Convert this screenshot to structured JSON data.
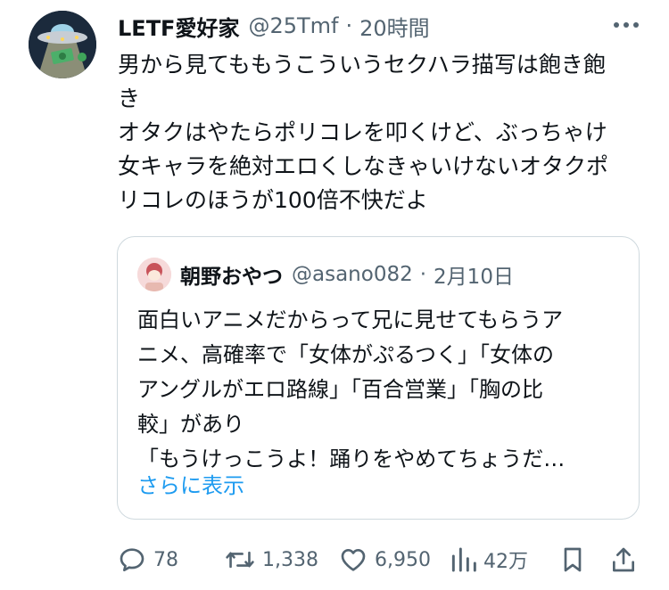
{
  "tweet": {
    "display_name": "LETF愛好家",
    "handle": "@25Tmf",
    "separator": "·",
    "time": "20時間",
    "text": "男から見てももうこういうセクハラ描写は飽き飽\nき\nオタクはやたらポリコレを叩くけど、ぶっちゃけ\n女キャラを絶対エロくしなきゃいけないオタクポ\nリコレのほうが100倍不快だよ"
  },
  "quote": {
    "display_name": "朝野おやつ",
    "handle": "@asano082",
    "separator": "·",
    "time": "2月10日",
    "text": "面白いアニメだからって兄に見せてもらうア\nニメ、高確率で「女体がぷるつく」「女体の\nアングルがエロ路線」「百合営業」「胸の比\n較」があり\n「もうけっこうよ！踊りをやめてちょうだ…",
    "show_more": "さらに表示"
  },
  "actions": {
    "replies": "78",
    "retweets": "1,338",
    "likes": "6,950",
    "views": "42万"
  },
  "icons": [
    "more-icon",
    "reply-icon",
    "retweet-icon",
    "like-icon",
    "views-icon",
    "bookmark-icon",
    "share-icon"
  ],
  "colors": {
    "text": "#0f1419",
    "secondary": "#536471",
    "link": "#1d9bf0",
    "border": "#cfd9de"
  }
}
